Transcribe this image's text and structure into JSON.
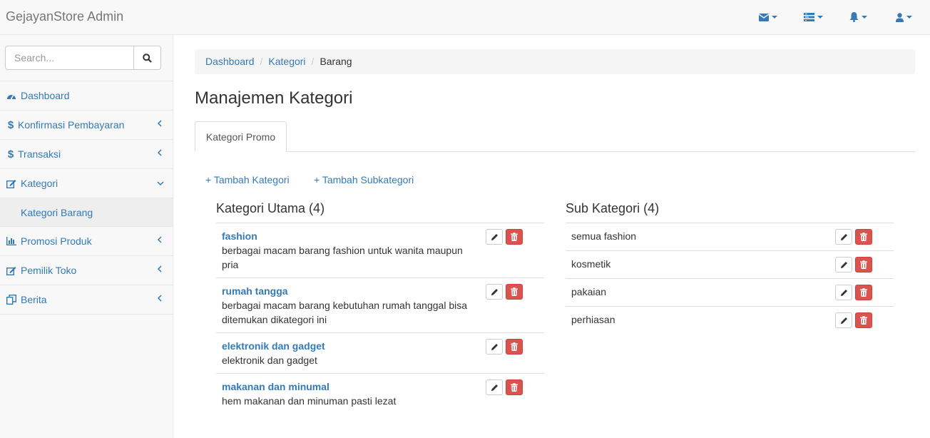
{
  "app": {
    "brand": "GejayanStore Admin"
  },
  "navbar": {
    "icons": [
      "envelope-icon",
      "tasks-icon",
      "bell-icon",
      "user-icon"
    ]
  },
  "sidebar": {
    "search_placeholder": "Search...",
    "items": [
      {
        "label": "Dashboard",
        "icon": "dashboard-icon"
      },
      {
        "label": "Konfirmasi Pembayaran",
        "icon": "dollar-icon"
      },
      {
        "label": "Transaksi",
        "icon": "dollar-icon"
      },
      {
        "label": "Kategori",
        "icon": "edit-icon"
      },
      {
        "label": "Kategori Barang"
      },
      {
        "label": "Promosi Produk",
        "icon": "bar-chart-icon"
      },
      {
        "label": "Pemilik Toko",
        "icon": "edit-icon"
      },
      {
        "label": "Berita",
        "icon": "copy-icon"
      }
    ]
  },
  "breadcrumb": {
    "items": [
      "Dashboard",
      "Kategori",
      "Barang"
    ],
    "separator": "/"
  },
  "page": {
    "title": "Manajemen Kategori",
    "tab": "Kategori Promo",
    "add_kategori": "+ Tambah Kategori",
    "add_subkategori": "+ Tambah Subkategori"
  },
  "kategori_utama": {
    "title": "Kategori Utama (4)",
    "items": [
      {
        "name": "fashion",
        "desc": "berbagai macam barang fashion untuk wanita maupun pria"
      },
      {
        "name": "rumah tangga",
        "desc": "berbagai macam barang kebutuhan rumah tanggal bisa ditemukan dikategori ini"
      },
      {
        "name": "elektronik dan gadget",
        "desc": "elektronik dan gadget"
      },
      {
        "name": "makanan dan minumal",
        "desc": "hem makanan dan minuman pasti lezat"
      }
    ]
  },
  "sub_kategori": {
    "title": "Sub Kategori (4)",
    "items": [
      "semua fashion",
      "kosmetik",
      "pakaian",
      "perhiasan"
    ]
  },
  "colors": {
    "link": "#337ab7",
    "danger": "#d9534f"
  }
}
